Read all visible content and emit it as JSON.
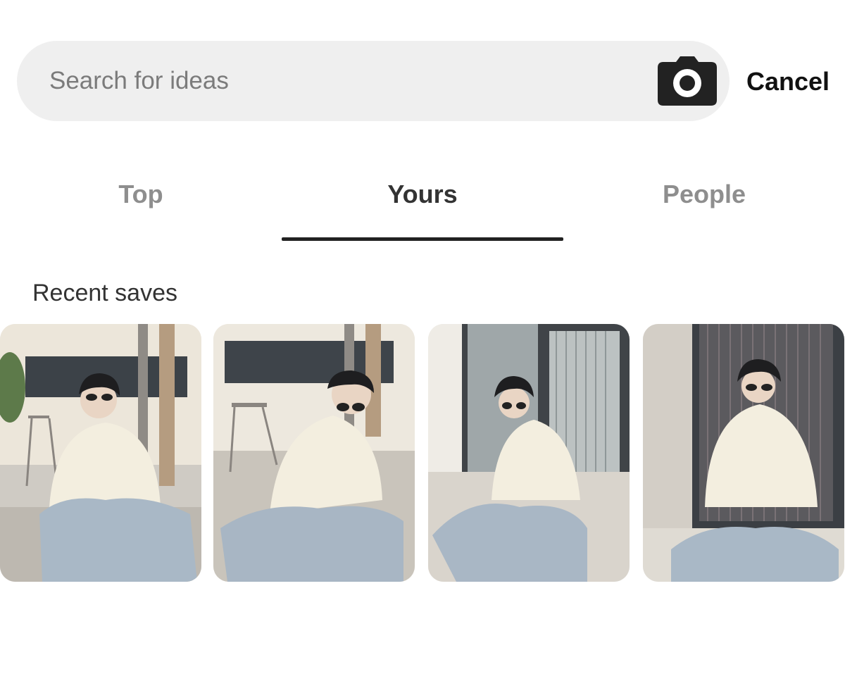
{
  "search": {
    "placeholder": "Search for ideas",
    "camera_icon": "camera-icon"
  },
  "cancel_label": "Cancel",
  "tabs": [
    {
      "label": "Top",
      "active": false
    },
    {
      "label": "Yours",
      "active": true
    },
    {
      "label": "People",
      "active": false
    }
  ],
  "recent_saves": {
    "title": "Recent saves",
    "pins": [
      {
        "type": "photo",
        "scene": "outdoor-courtyard"
      },
      {
        "type": "photo",
        "scene": "outdoor-courtyard"
      },
      {
        "type": "photo",
        "scene": "window-ledge"
      },
      {
        "type": "photo",
        "scene": "window-ledge"
      }
    ]
  },
  "colors": {
    "search_bg": "#efefef",
    "active_tab": "#333333",
    "inactive_tab": "#8e8e8e",
    "underline": "#222222"
  }
}
